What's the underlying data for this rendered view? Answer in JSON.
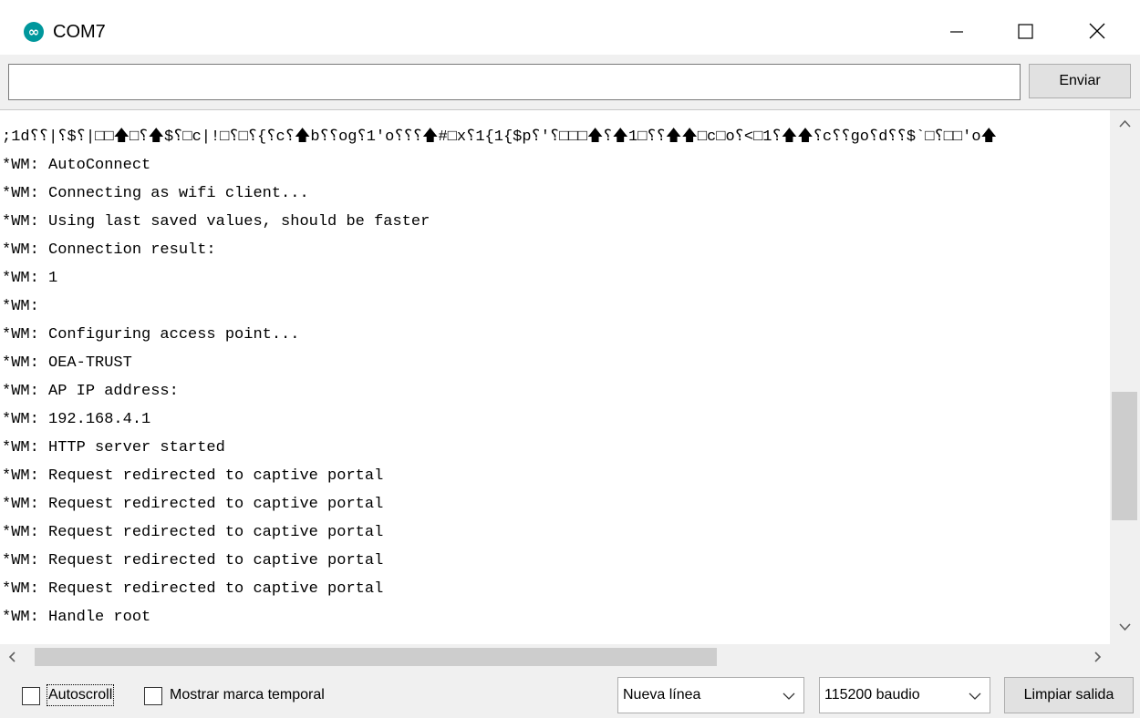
{
  "window": {
    "title": "COM7",
    "controls": {
      "minimize": "minimize",
      "maximize": "maximize",
      "close": "close"
    }
  },
  "send": {
    "input_value": "",
    "button_label": "Enviar"
  },
  "output": {
    "lines": [
      ";1d⸮⸮|⸮$⸮|□□🡅□⸮🡅$⸮□c|!□⸮□⸮{⸮c⸮🡅b⸮⸮og⸮1'o⸮⸮⸮🡅#□x⸮1{1{$p⸮'⸮□□□🡅⸮🡅1□⸮⸮🡅🡅□c□o⸮<□1⸮🡅🡅⸮c⸮⸮go⸮d⸮⸮$`□⸮□□'o🡅",
      "*WM: AutoConnect",
      "*WM: Connecting as wifi client...",
      "*WM: Using last saved values, should be faster",
      "*WM: Connection result:",
      "*WM: 1",
      "*WM:",
      "*WM: Configuring access point...",
      "*WM: OEA-TRUST",
      "*WM: AP IP address:",
      "*WM: 192.168.4.1",
      "*WM: HTTP server started",
      "*WM: Request redirected to captive portal",
      "*WM: Request redirected to captive portal",
      "*WM: Request redirected to captive portal",
      "*WM: Request redirected to captive portal",
      "*WM: Request redirected to captive portal",
      "*WM: Handle root"
    ]
  },
  "bottom": {
    "autoscroll_label": "Autoscroll",
    "autoscroll_checked": false,
    "timestamp_label": "Mostrar marca temporal",
    "timestamp_checked": false,
    "line_ending_selected": "Nueva línea",
    "baud_selected": "115200 baudio",
    "clear_label": "Limpiar salida"
  },
  "colors": {
    "arduino_teal": "#00979c",
    "chrome_bg": "#f0f0f0",
    "button_bg": "#e1e1e1",
    "scroll_thumb": "#cdcdcd"
  },
  "icons": {
    "app": "arduino-logo-icon",
    "scroll_up": "chevron-up-icon",
    "scroll_down": "chevron-down-icon",
    "scroll_left": "chevron-left-icon",
    "scroll_right": "chevron-right-icon",
    "dropdown": "chevron-down-icon"
  }
}
